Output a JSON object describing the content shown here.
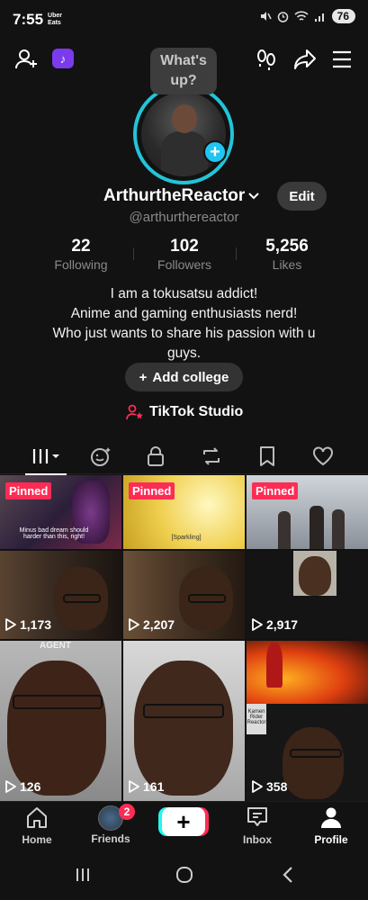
{
  "status_bar": {
    "time": "7:55",
    "uber_line1": "Uber",
    "uber_line2": "Eats",
    "battery": "76"
  },
  "top_bar": {
    "tiktok_badge": "♪",
    "icons": [
      "add-friend-icon",
      "footprints-icon",
      "share-icon",
      "menu-icon"
    ]
  },
  "bubble": {
    "text_line1": "What's",
    "text_line2": "up?"
  },
  "profile": {
    "username": "ArthurtheReactor",
    "handle": "@arthurthereactor",
    "edit_label": "Edit"
  },
  "stats": [
    {
      "value": "22",
      "label": "Following"
    },
    {
      "value": "102",
      "label": "Followers"
    },
    {
      "value": "5,256",
      "label": "Likes"
    }
  ],
  "bio": {
    "line1": "I am a tokusatsu addict!",
    "line2": "Anime and gaming enthusiasts nerd!",
    "line3": "Who just wants to share his passion with u",
    "line4": "guys."
  },
  "add_college": {
    "plus": "+",
    "label": "Add college"
  },
  "studio": {
    "label": "TikTok Studio"
  },
  "tabs": [
    "videos",
    "reposts-liked",
    "private",
    "reposts",
    "favorites",
    "liked"
  ],
  "videos": [
    {
      "pinned": "Pinned",
      "views": "",
      "caption": "Minus bad dream should harder than this, right!"
    },
    {
      "pinned": "Pinned",
      "views": "",
      "caption": "[Sparkling]"
    },
    {
      "pinned": "Pinned",
      "views": "",
      "caption": ""
    },
    {
      "pinned": "",
      "views": "1,173",
      "caption": ""
    },
    {
      "pinned": "",
      "views": "2,207",
      "caption": ""
    },
    {
      "pinned": "",
      "views": "2,917",
      "caption": ""
    },
    {
      "pinned": "",
      "views": "126",
      "caption": "AGENT"
    },
    {
      "pinned": "",
      "views": "161",
      "caption": ""
    },
    {
      "pinned": "",
      "views": "358",
      "caption": "Kamen Rider Reactor"
    }
  ],
  "bottom_nav": {
    "home": "Home",
    "friends": "Friends",
    "friends_badge": "2",
    "create": "+",
    "inbox": "Inbox",
    "profile": "Profile"
  },
  "colors": {
    "background": "#121212",
    "accent_pink": "#fe2c55",
    "accent_cyan": "#25f4ee",
    "ring": "#22c4d8"
  }
}
